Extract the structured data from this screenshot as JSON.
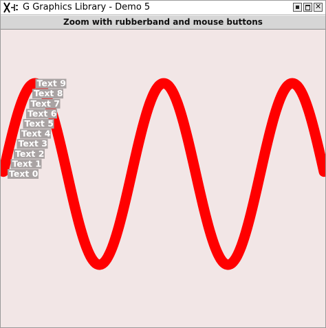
{
  "window": {
    "title": "G Graphics Library - Demo 5",
    "icon": "x-window-icon",
    "controls": [
      "minimize-icon",
      "maximize-icon",
      "close-icon"
    ]
  },
  "instruction": "Zoom with rubberband and mouse buttons",
  "colors": {
    "background": "#f2e6e6",
    "curve": "#ff0000",
    "label_box": "#a9a3a3",
    "label_text": "#ffffff"
  },
  "labels": [
    "Text 0",
    "Text 1",
    "Text 2",
    "Text 3",
    "Text 4",
    "Text 5",
    "Text 6",
    "Text 7",
    "Text 8",
    "Text 9"
  ]
}
